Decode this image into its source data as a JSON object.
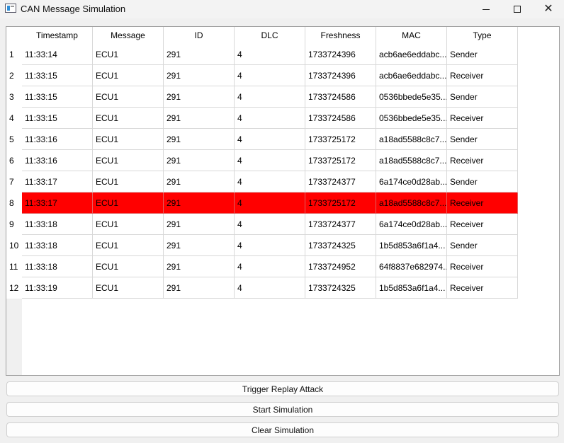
{
  "window": {
    "title": "CAN Message Simulation",
    "icon": "app-window-icon",
    "controls": [
      "minimize-icon",
      "maximize-icon",
      "close-icon"
    ]
  },
  "table": {
    "columns": [
      "Timestamp",
      "Message",
      "ID",
      "DLC",
      "Freshness",
      "MAC",
      "Type"
    ],
    "rows": [
      {
        "index": "1",
        "cells": [
          "11:33:14",
          "ECU1",
          "291",
          "4",
          "1733724396",
          "acb6ae6eddabc...",
          "Sender"
        ]
      },
      {
        "index": "2",
        "cells": [
          "11:33:15",
          "ECU1",
          "291",
          "4",
          "1733724396",
          "acb6ae6eddabc...",
          "Receiver"
        ]
      },
      {
        "index": "3",
        "cells": [
          "11:33:15",
          "ECU1",
          "291",
          "4",
          "1733724586",
          "0536bbede5e35...",
          "Sender"
        ]
      },
      {
        "index": "4",
        "cells": [
          "11:33:15",
          "ECU1",
          "291",
          "4",
          "1733724586",
          "0536bbede5e35...",
          "Receiver"
        ]
      },
      {
        "index": "5",
        "cells": [
          "11:33:16",
          "ECU1",
          "291",
          "4",
          "1733725172",
          "a18ad5588c8c7...",
          "Sender"
        ]
      },
      {
        "index": "6",
        "cells": [
          "11:33:16",
          "ECU1",
          "291",
          "4",
          "1733725172",
          "a18ad5588c8c7...",
          "Receiver"
        ]
      },
      {
        "index": "7",
        "cells": [
          "11:33:17",
          "ECU1",
          "291",
          "4",
          "1733724377",
          "6a174ce0d28ab...",
          "Sender"
        ]
      },
      {
        "index": "8",
        "cells": [
          "11:33:17",
          "ECU1",
          "291",
          "4",
          "1733725172",
          "a18ad5588c8c7...",
          "Receiver"
        ],
        "highlight": true
      },
      {
        "index": "9",
        "cells": [
          "11:33:18",
          "ECU1",
          "291",
          "4",
          "1733724377",
          "6a174ce0d28ab...",
          "Receiver"
        ]
      },
      {
        "index": "10",
        "cells": [
          "11:33:18",
          "ECU1",
          "291",
          "4",
          "1733724325",
          "1b5d853a6f1a4...",
          "Sender"
        ]
      },
      {
        "index": "11",
        "cells": [
          "11:33:18",
          "ECU1",
          "291",
          "4",
          "1733724952",
          "64f8837e682974...",
          "Receiver"
        ]
      },
      {
        "index": "12",
        "cells": [
          "11:33:19",
          "ECU1",
          "291",
          "4",
          "1733724325",
          "1b5d853a6f1a4...",
          "Receiver"
        ]
      }
    ],
    "highlight_color": "#ff0000"
  },
  "buttons": {
    "replay": "Trigger Replay Attack",
    "start": "Start Simulation",
    "clear": "Clear Simulation"
  }
}
